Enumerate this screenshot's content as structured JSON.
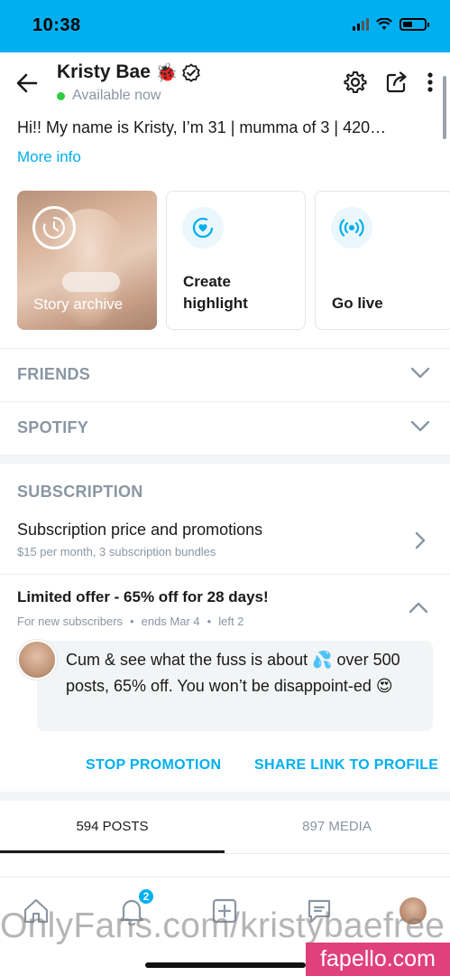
{
  "status_bar": {
    "time": "10:38"
  },
  "header": {
    "name": "Kristy Bae",
    "name_emoji": "🐞",
    "availability": "Available now"
  },
  "bio": {
    "text": "Hi!! My name is Kristy, I’m 31 | mumma of 3 | 420…",
    "more_info": "More info"
  },
  "cards": [
    {
      "label": "Story archive",
      "icon": "clock-icon"
    },
    {
      "label_line1": "Create",
      "label_line2": "highlight",
      "icon": "heart-circle-icon"
    },
    {
      "label": "Go live",
      "icon": "broadcast-icon"
    }
  ],
  "sections": {
    "friends": "FRIENDS",
    "spotify": "SPOTIFY"
  },
  "subscription": {
    "heading": "SUBSCRIPTION",
    "price_title": "Subscription price and promotions",
    "price_subtitle": "$15 per month, 3 subscription bundles"
  },
  "offer": {
    "title": "Limited offer - 65% off for 28 days!",
    "audience": "For new subscribers",
    "ends": "ends Mar 4",
    "left": "left 2",
    "message": "Cum & see what the fuss is about 💦 over 500 posts, 65% off. You won’t be disappoint-ed 😍",
    "stop_label": "STOP PROMOTION",
    "share_label": "SHARE LINK TO PROFILE"
  },
  "tabs": {
    "posts": "594 POSTS",
    "media": "897 MEDIA"
  },
  "bottom_nav": {
    "notifications_count": "2"
  },
  "overlays": {
    "watermark": "OnlyFans.com/kristybaefree",
    "brand": "fapello.com"
  },
  "colors": {
    "accent": "#00aff0",
    "muted": "#8a96a3",
    "online": "#2ecc40",
    "brand_badge": "#e0407c"
  }
}
